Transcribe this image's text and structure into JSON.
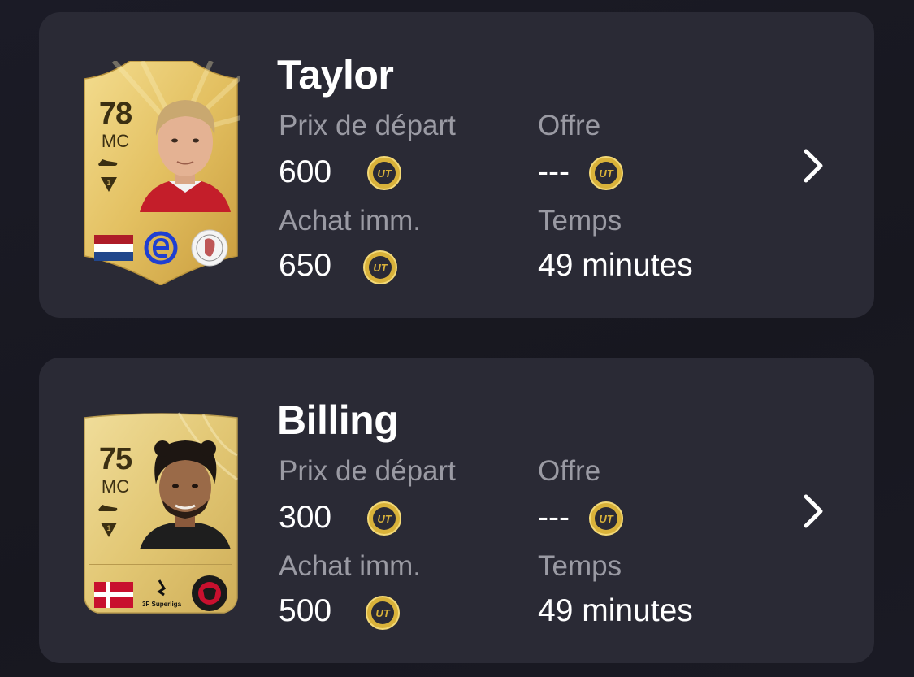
{
  "listings": [
    {
      "player_name": "Taylor",
      "card": {
        "rating": "78",
        "position": "MC",
        "chemistry": "1",
        "nation": "Netherlands flag",
        "league": "Eredivisie logo",
        "club": "Ajax crest"
      },
      "start_price_label": "Prix de départ",
      "start_price": "600",
      "buy_now_label": "Achat imm.",
      "buy_now": "650",
      "bid_label": "Offre",
      "bid": "---",
      "time_label": "Temps",
      "time": "49 minutes"
    },
    {
      "player_name": "Billing",
      "card": {
        "rating": "75",
        "position": "MC",
        "chemistry": "1",
        "nation": "Denmark flag",
        "league": "3F Superliga",
        "club": "FC Midtjylland crest"
      },
      "start_price_label": "Prix de départ",
      "start_price": "300",
      "buy_now_label": "Achat imm.",
      "buy_now": "500",
      "bid_label": "Offre",
      "bid": "---",
      "time_label": "Temps",
      "time": "49 minutes"
    }
  ],
  "currency_icon": "ut-coin-icon",
  "colors": {
    "card_bg": "#2a2a35",
    "label": "#9a9aa3",
    "value": "#ffffff",
    "gold": "#e5c366",
    "coin": "#d9b23a"
  }
}
